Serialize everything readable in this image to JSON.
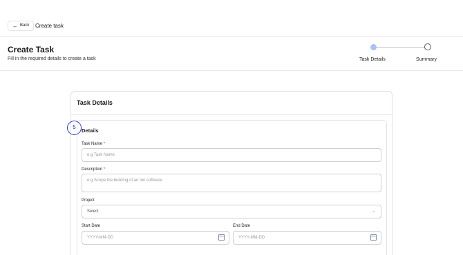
{
  "topbar": {
    "back_label": "Back",
    "back_icon": "arrow-left-icon",
    "breadcrumb": "Create task"
  },
  "header": {
    "title": "Create Task",
    "subtitle": "Fill in the required details to create a task"
  },
  "stepper": {
    "steps": [
      "Task Details",
      "Summary"
    ],
    "active_index": 0,
    "active_color": "#a9c3ef"
  },
  "card": {
    "title": "Task Details"
  },
  "details": {
    "badge": "5",
    "section_title": "Details",
    "task_name": {
      "label": "Task Name",
      "required": "*",
      "placeholder": "e.g Task Name"
    },
    "description": {
      "label": "Description",
      "required": "*",
      "placeholder": "e.g Scope the building of an okr software"
    },
    "project": {
      "label": "Project",
      "value": "Select"
    },
    "start_date": {
      "label": "Start Date",
      "placeholder": "YYYY-MM-DD"
    },
    "end_date": {
      "label": "End Date",
      "placeholder": "YYYY-MM-DD"
    }
  },
  "colors": {
    "required": "#d21f1f",
    "badge_border": "#2f3fb3"
  }
}
